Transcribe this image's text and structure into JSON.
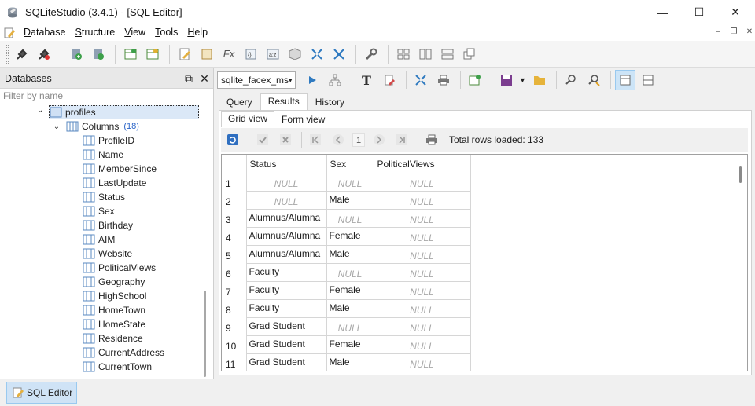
{
  "window": {
    "title": "SQLiteStudio (3.4.1) - [SQL Editor]",
    "minimize": "—",
    "maximize": "☐",
    "close": "✕"
  },
  "menubar": {
    "items": [
      "Database",
      "Structure",
      "View",
      "Tools",
      "Help"
    ],
    "mdi_minimize": "–",
    "mdi_restore": "❐",
    "mdi_close": "✕"
  },
  "databases_panel": {
    "title": "Databases",
    "filter_placeholder": "Filter by name",
    "table_name": "profiles",
    "columns_label": "Columns",
    "columns_count": "(18)",
    "columns": [
      "ProfileID",
      "Name",
      "MemberSince",
      "LastUpdate",
      "Status",
      "Sex",
      "Birthday",
      "AIM",
      "Website",
      "PoliticalViews",
      "Geography",
      "HighSchool",
      "HomeTown",
      "HomeState",
      "Residence",
      "CurrentAddress",
      "CurrentTown"
    ]
  },
  "editor": {
    "database_select": "sqlite_facex_ms",
    "tabs": [
      "Query",
      "Results",
      "History"
    ],
    "active_tab": "Results",
    "subtabs": [
      "Grid view",
      "Form view"
    ],
    "active_subtab": "Grid view",
    "page_number": "1",
    "rows_loaded": "Total rows loaded: 133"
  },
  "grid": {
    "columns": [
      "Status",
      "Sex",
      "PoliticalViews"
    ],
    "null_text": "NULL",
    "rows": [
      {
        "n": "1",
        "status": null,
        "sex": null,
        "politicalviews": null
      },
      {
        "n": "2",
        "status": null,
        "sex": "Male",
        "politicalviews": null
      },
      {
        "n": "3",
        "status": "Alumnus/Alumna",
        "sex": null,
        "politicalviews": null
      },
      {
        "n": "4",
        "status": "Alumnus/Alumna",
        "sex": "Female",
        "politicalviews": null
      },
      {
        "n": "5",
        "status": "Alumnus/Alumna",
        "sex": "Male",
        "politicalviews": null
      },
      {
        "n": "6",
        "status": "Faculty",
        "sex": null,
        "politicalviews": null
      },
      {
        "n": "7",
        "status": "Faculty",
        "sex": "Female",
        "politicalviews": null
      },
      {
        "n": "8",
        "status": "Faculty",
        "sex": "Male",
        "politicalviews": null
      },
      {
        "n": "9",
        "status": "Grad Student",
        "sex": null,
        "politicalviews": null
      },
      {
        "n": "10",
        "status": "Grad Student",
        "sex": "Female",
        "politicalviews": null
      },
      {
        "n": "11",
        "status": "Grad Student",
        "sex": "Male",
        "politicalviews": null
      }
    ]
  },
  "taskbar": {
    "item_label": "SQL Editor"
  },
  "colors": {
    "accent": "#2a64c8",
    "selection": "#dbe8f7",
    "null_text": "#a8a8a8"
  }
}
